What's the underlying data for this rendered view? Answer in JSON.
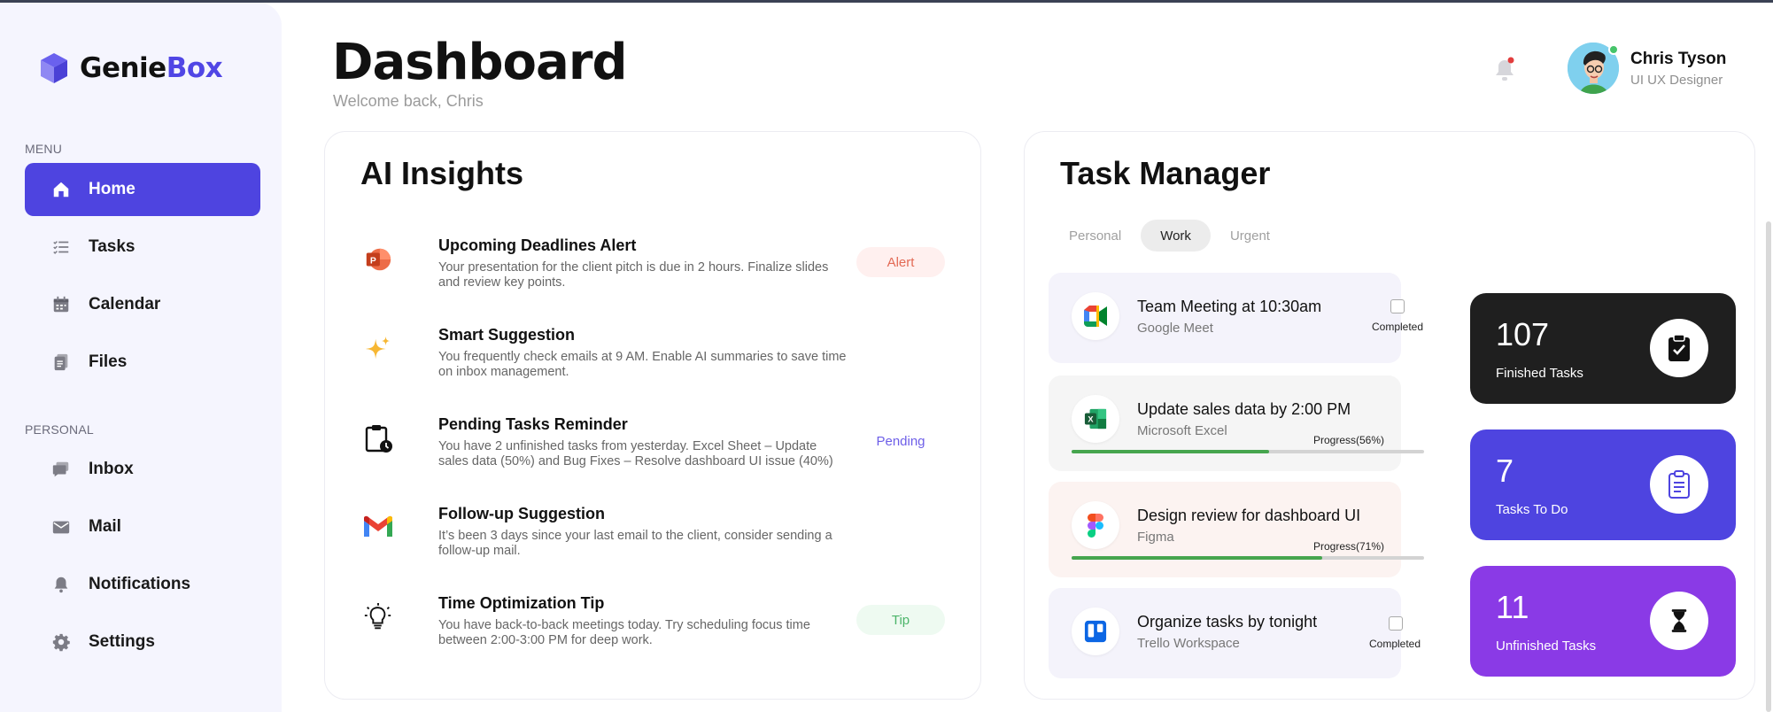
{
  "app": {
    "logo_part1": "Genie",
    "logo_part2": "Box"
  },
  "sidebar": {
    "menu_label": "MENU",
    "personal_label": "PERSONAL",
    "menu_items": [
      {
        "label": "Home",
        "icon": "home-icon",
        "active": true
      },
      {
        "label": "Tasks",
        "icon": "list-icon"
      },
      {
        "label": "Calendar",
        "icon": "calendar-icon"
      },
      {
        "label": "Files",
        "icon": "file-icon"
      }
    ],
    "personal_items": [
      {
        "label": "Inbox",
        "icon": "chat-icon"
      },
      {
        "label": "Mail",
        "icon": "mail-icon"
      },
      {
        "label": "Notifications",
        "icon": "bell-icon"
      },
      {
        "label": "Settings",
        "icon": "gear-icon"
      }
    ]
  },
  "header": {
    "title": "Dashboard",
    "subtitle": "Welcome back, Chris",
    "user_name": "Chris Tyson",
    "user_role": "UI UX Designer"
  },
  "insights": {
    "title": "AI Insights",
    "items": [
      {
        "title": "Upcoming Deadlines Alert",
        "desc": "Your presentation for the client pitch is due in 2 hours. Finalize slides and review key points.",
        "tag": "Alert",
        "icon": "powerpoint-icon"
      },
      {
        "title": "Smart Suggestion",
        "desc": "You frequently check emails at 9 AM. Enable AI summaries to save time on inbox management.",
        "tag": "",
        "icon": "sparkle-icon"
      },
      {
        "title": "Pending Tasks Reminder",
        "desc": "You have 2 unfinished tasks from yesterday. Excel Sheet – Update sales data (50%) and Bug Fixes – Resolve dashboard UI issue (40%)",
        "tag": "Pending",
        "icon": "clipboard-clock-icon"
      },
      {
        "title": "Follow-up Suggestion",
        "desc": "It’s been 3 days since your last email to the client, consider sending a follow-up mail.",
        "tag": "",
        "icon": "gmail-icon"
      },
      {
        "title": "Time Optimization Tip",
        "desc": "You have back-to-back meetings today. Try scheduling focus time between 2:00-3:00 PM for deep work.",
        "tag": "Tip",
        "icon": "lightbulb-icon"
      }
    ]
  },
  "tasks": {
    "title": "Task Manager",
    "tabs": [
      "Personal",
      "Work",
      "Urgent"
    ],
    "active_tab": "Work",
    "items": [
      {
        "title": "Team Meeting at 10:30am",
        "app": "Google Meet",
        "status": "Completed",
        "icon": "google-meet-icon"
      },
      {
        "title": "Update sales data by 2:00 PM",
        "app": "Microsoft Excel",
        "progress_label": "Progress(56%)",
        "progress": 0.56,
        "icon": "excel-icon"
      },
      {
        "title": "Design review for dashboard UI",
        "app": "Figma",
        "progress_label": "Progress(71%)",
        "progress": 0.71,
        "icon": "figma-icon"
      },
      {
        "title": "Organize tasks by tonight",
        "app": "Trello Workspace",
        "status": "Completed",
        "icon": "trello-icon"
      }
    ],
    "stats": [
      {
        "value": "107",
        "label": "Finished Tasks",
        "color": "#1f1f1f",
        "icon": "clipboard-check-icon"
      },
      {
        "value": "7",
        "label": "Tasks To Do",
        "color": "#4e44e0",
        "icon": "clipboard-list-icon"
      },
      {
        "value": "11",
        "label": "Unfinished Tasks",
        "color": "#8a3ae6",
        "icon": "hourglass-icon"
      }
    ]
  },
  "colors": {
    "accent": "#4e44e0",
    "brand": "#5046e5",
    "progress": "#46a54e"
  }
}
